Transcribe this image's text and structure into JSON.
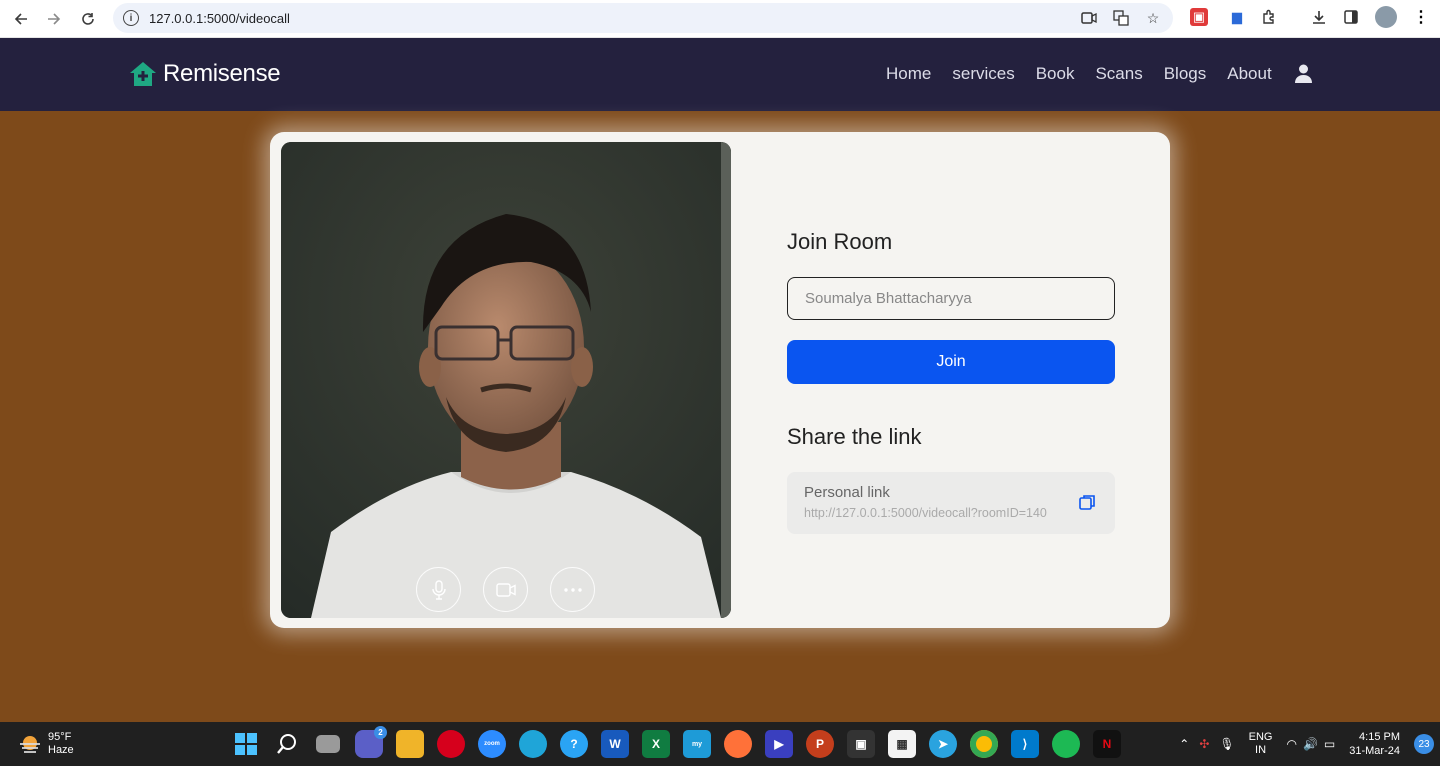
{
  "browser": {
    "url": "127.0.0.1:5000/videocall"
  },
  "header": {
    "brand": "Remisense",
    "menu": [
      "Home",
      "services",
      "Book",
      "Scans",
      "Blogs",
      "About"
    ]
  },
  "join": {
    "title": "Join Room",
    "name_value": "Soumalya Bhattacharyya",
    "button_label": "Join"
  },
  "share": {
    "title": "Share the link",
    "link_label": "Personal link",
    "link_url": "http://127.0.0.1:5000/videocall?roomID=140"
  },
  "video_controls": [
    "mic-icon",
    "camera-icon",
    "more-icon"
  ],
  "colors": {
    "background": "#7e4a1a",
    "header": "#24213e",
    "join_button": "#0a55f0",
    "brand_icon": "#1fa883"
  },
  "taskbar": {
    "weather_temp": "95°F",
    "weather_desc": "Haze",
    "chat_badge": "2",
    "lang_top": "ENG",
    "lang_bottom": "IN",
    "time": "4:15 PM",
    "date": "31-Mar-24",
    "notifications": "23"
  }
}
